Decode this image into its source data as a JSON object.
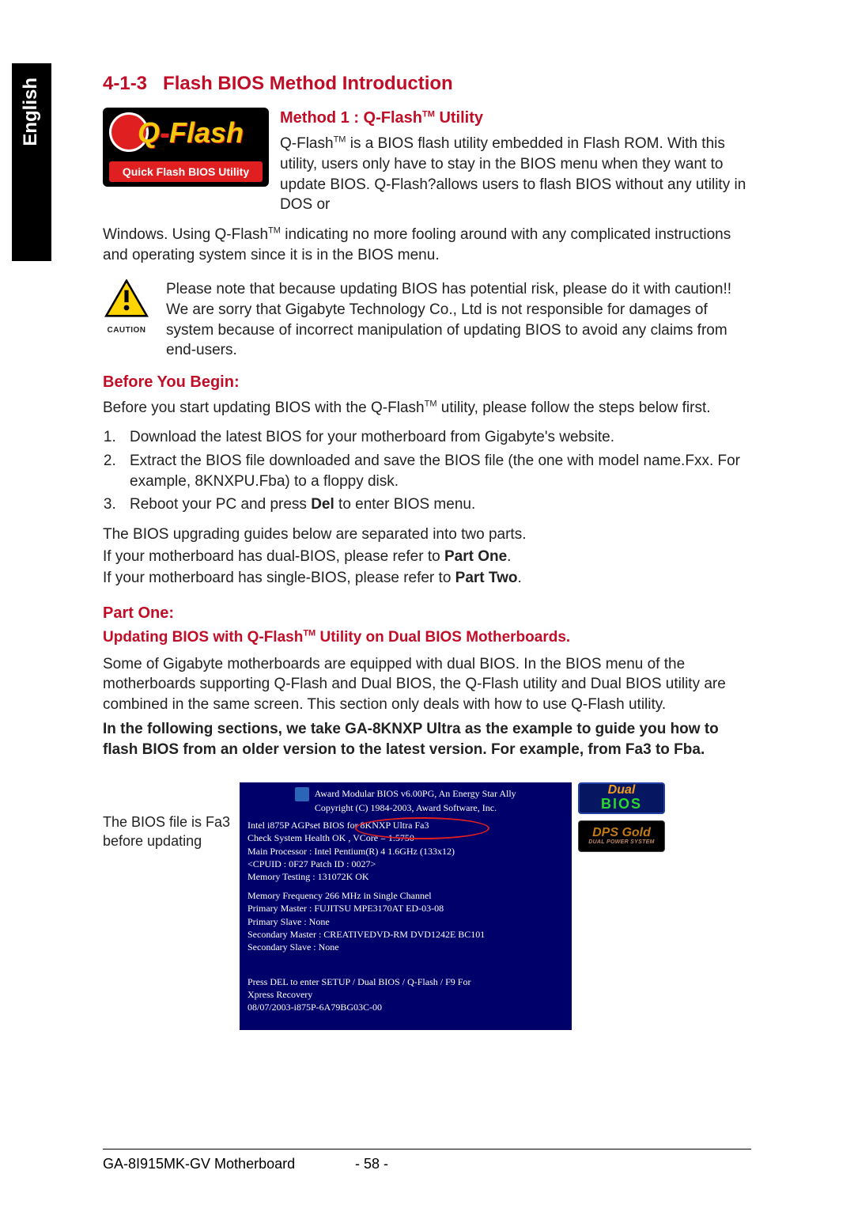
{
  "lang_tab": "English",
  "section_number": "4-1-3",
  "section_title": "Flash BIOS Method Introduction",
  "qflash_logo": {
    "wordmark_prefix": "Q",
    "wordmark_dash": "-",
    "wordmark_suffix": "Flash",
    "strip": "Quick Flash BIOS Utility"
  },
  "method1": {
    "heading_prefix": "Method 1 : Q-Flash",
    "heading_tm": "TM",
    "heading_suffix": " Utility",
    "para1_a": "Q-Flash",
    "para1_tm": "TM",
    "para1_b": " is a BIOS flash utility embedded in Flash ROM. With this utility, users only have to stay in the BIOS menu when they want to update BIOS. Q-Flash?allows users to flash BIOS without any utility in DOS or",
    "para1_c_a": "Windows. Using Q-Flash",
    "para1_c_tm": "TM",
    "para1_c_b": " indicating no more fooling around with any complicated instructions and operating system since it is in the BIOS menu."
  },
  "caution": {
    "label": "CAUTION",
    "text": "Please note that because updating BIOS has potential risk, please do it with caution!! We are sorry that Gigabyte Technology Co., Ltd is not responsible for damages of system because of incorrect manipulation of updating BIOS to avoid any claims from end-users."
  },
  "before": {
    "heading": "Before You Begin:",
    "intro_a": "Before you start updating BIOS with the Q-Flash",
    "intro_tm": "TM",
    "intro_b": " utility, please follow the steps below first.",
    "steps": [
      "Download the latest BIOS for your motherboard from Gigabyte's website.",
      "Extract the BIOS file downloaded and save the BIOS file (the one with model name.Fxx. For example, 8KNXPU.Fba) to a floppy disk.",
      {
        "pre": "Reboot your PC and press ",
        "bold": "Del",
        "post": " to enter BIOS menu."
      }
    ]
  },
  "guide_notes": {
    "l1": "The BIOS upgrading guides below are separated into two parts.",
    "l2_a": "If your motherboard has dual-BIOS, please refer to ",
    "l2_b": "Part One",
    "l2_c": ".",
    "l3_a": "If your motherboard has single-BIOS, please refer to ",
    "l3_b": "Part Two",
    "l3_c": "."
  },
  "part_one": {
    "heading": "Part One:",
    "sub_a": "Updating BIOS with Q-Flash",
    "sub_tm": "TM",
    "sub_b": " Utility on Dual BIOS Motherboards.",
    "para": "Some of Gigabyte motherboards are equipped with dual BIOS. In the BIOS menu of the motherboards supporting Q-Flash and Dual BIOS, the Q-Flash utility and Dual BIOS utility are combined in the same screen. This section only deals with how to use Q-Flash utility.",
    "emph": "In the following sections, we take GA-8KNXP Ultra as the example to guide you how to flash BIOS from an older version to the latest version. For example, from Fa3 to Fba."
  },
  "bios_caption": "The BIOS file is Fa3 before updating",
  "bios_screen": {
    "hdr1": "Award Modular BIOS v6.00PG, An Energy Star Ally",
    "hdr2": "Copyright (C) 1984-2003, Award Software, Inc.",
    "b1_l1": "Intel i875P AGPset BIOS for 8KNXP Ultra Fa3",
    "b1_l2": "Check System Health OK , VCore = 1.5750",
    "b1_l3": "Main Processor : Intel Pentium(R) 4  1.6GHz (133x12)",
    "b1_l4": "<CPUID : 0F27 Patch ID  : 0027>",
    "b1_l5": "Memory Testing  : 131072K OK",
    "b2_l1": "Memory Frequency 266 MHz in Single Channel",
    "b2_l2": "Primary Master : FUJITSU MPE3170AT ED-03-08",
    "b2_l3": "Primary Slave : None",
    "b2_l4": "Secondary Master :  CREATIVEDVD-RM DVD1242E BC101",
    "b2_l5": "Secondary Slave : None",
    "f1": "Press DEL to enter SETUP / Dual BIOS / Q-Flash / F9 For",
    "f2": "Xpress Recovery",
    "f3": "08/07/2003-i875P-6A79BG03C-00"
  },
  "badges": {
    "dual_top": "Dual",
    "dual_bottom": "BIOS",
    "dps_top": "DPS Gold",
    "dps_bottom": "DUAL POWER SYSTEM"
  },
  "footer": {
    "model": "GA-8I915MK-GV Motherboard",
    "page": "- 58 -"
  }
}
